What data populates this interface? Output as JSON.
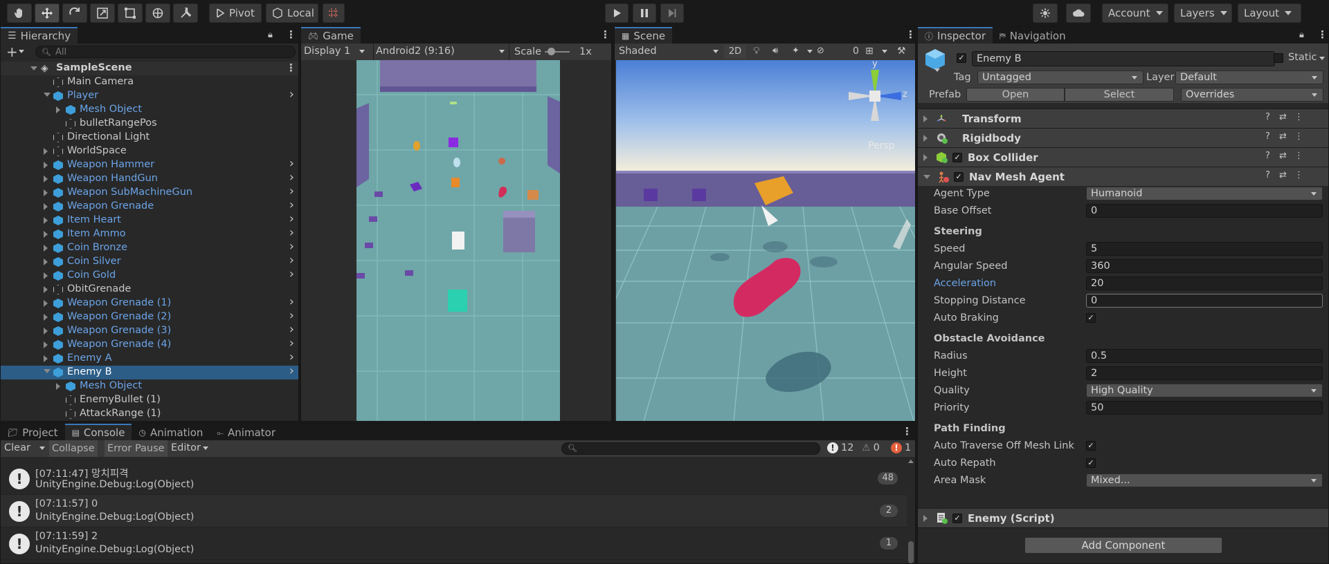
{
  "toolbar": {
    "pivot": "Pivot",
    "local": "Local",
    "account": "Account",
    "layers": "Layers",
    "layout": "Layout"
  },
  "hierarchy": {
    "tab": "Hierarchy",
    "search_placeholder": "All",
    "scene": "SampleScene",
    "items": [
      {
        "label": "Main Camera",
        "indent": 1,
        "icon": "cube-grey",
        "arrow": "",
        "blue": false,
        "chev": false
      },
      {
        "label": "Player",
        "indent": 1,
        "icon": "cube-blue",
        "arrow": "down",
        "blue": true,
        "chev": true
      },
      {
        "label": "Mesh Object",
        "indent": 2,
        "icon": "cube-blue",
        "arrow": "right",
        "blue": true,
        "chev": false
      },
      {
        "label": "bulletRangePos",
        "indent": 2,
        "icon": "cube-grey-fx",
        "arrow": "",
        "blue": false,
        "chev": false
      },
      {
        "label": "Directional Light",
        "indent": 1,
        "icon": "cube-grey",
        "arrow": "",
        "blue": false,
        "chev": false
      },
      {
        "label": "WorldSpace",
        "indent": 1,
        "icon": "cube-grey",
        "arrow": "right",
        "blue": false,
        "chev": false
      },
      {
        "label": "Weapon Hammer",
        "indent": 1,
        "icon": "cube-blue",
        "arrow": "right",
        "blue": true,
        "chev": true
      },
      {
        "label": "Weapon HandGun",
        "indent": 1,
        "icon": "cube-blue",
        "arrow": "right",
        "blue": true,
        "chev": true
      },
      {
        "label": "Weapon SubMachineGun",
        "indent": 1,
        "icon": "cube-blue",
        "arrow": "right",
        "blue": true,
        "chev": true
      },
      {
        "label": "Weapon Grenade",
        "indent": 1,
        "icon": "cube-blue",
        "arrow": "right",
        "blue": true,
        "chev": true
      },
      {
        "label": "Item Heart",
        "indent": 1,
        "icon": "cube-blue",
        "arrow": "right",
        "blue": true,
        "chev": true
      },
      {
        "label": "Item Ammo",
        "indent": 1,
        "icon": "cube-blue",
        "arrow": "right",
        "blue": true,
        "chev": true
      },
      {
        "label": "Coin Bronze",
        "indent": 1,
        "icon": "cube-blue",
        "arrow": "right",
        "blue": true,
        "chev": true
      },
      {
        "label": "Coin Silver",
        "indent": 1,
        "icon": "cube-blue",
        "arrow": "right",
        "blue": true,
        "chev": true
      },
      {
        "label": "Coin Gold",
        "indent": 1,
        "icon": "cube-blue",
        "arrow": "right",
        "blue": true,
        "chev": true
      },
      {
        "label": "ObitGrenade",
        "indent": 1,
        "icon": "cube-grey",
        "arrow": "right",
        "blue": false,
        "chev": false
      },
      {
        "label": "Weapon Grenade (1)",
        "indent": 1,
        "icon": "cube-blue",
        "arrow": "right",
        "blue": true,
        "chev": true
      },
      {
        "label": "Weapon Grenade (2)",
        "indent": 1,
        "icon": "cube-blue",
        "arrow": "right",
        "blue": true,
        "chev": true
      },
      {
        "label": "Weapon Grenade (3)",
        "indent": 1,
        "icon": "cube-blue",
        "arrow": "right",
        "blue": true,
        "chev": true
      },
      {
        "label": "Weapon Grenade (4)",
        "indent": 1,
        "icon": "cube-blue",
        "arrow": "right",
        "blue": true,
        "chev": true
      },
      {
        "label": "Enemy A",
        "indent": 1,
        "icon": "cube-blue",
        "arrow": "right",
        "blue": true,
        "chev": true
      },
      {
        "label": "Enemy B",
        "indent": 1,
        "icon": "cube-blue",
        "arrow": "down",
        "blue": false,
        "chev": true,
        "selected": true
      },
      {
        "label": "Mesh Object",
        "indent": 2,
        "icon": "cube-blue",
        "arrow": "right",
        "blue": true,
        "chev": false
      },
      {
        "label": "EnemyBullet (1)",
        "indent": 2,
        "icon": "cube-grey",
        "arrow": "",
        "blue": false,
        "chev": false
      },
      {
        "label": "AttackRange (1)",
        "indent": 2,
        "icon": "cube-grey-fx",
        "arrow": "",
        "blue": false,
        "chev": false
      }
    ]
  },
  "game": {
    "tab": "Game",
    "display": "Display 1",
    "aspect": "Android2 (9:16)",
    "scale_label": "Scale",
    "scale_value": "1x"
  },
  "scene": {
    "tab": "Scene",
    "shading": "Shaded",
    "mode2d": "2D",
    "hidden_count": "0",
    "gizmo_y": "y",
    "gizmo_z": "z",
    "persp": "Persp"
  },
  "inspector": {
    "tab": "Inspector",
    "tab2": "Navigation",
    "object_name": "Enemy B",
    "static": "Static",
    "tag_label": "Tag",
    "tag_value": "Untagged",
    "layer_label": "Layer",
    "layer_value": "Default",
    "prefab_label": "Prefab",
    "prefab_open": "Open",
    "prefab_select": "Select",
    "prefab_overrides": "Overrides",
    "components": {
      "transform": "Transform",
      "rigidbody": "Rigidbody",
      "box_collider": "Box Collider",
      "nav_mesh_agent": "Nav Mesh Agent",
      "enemy_script": "Enemy (Script)"
    },
    "nav": {
      "agent_type_label": "Agent Type",
      "agent_type": "Humanoid",
      "base_offset_label": "Base Offset",
      "base_offset": "0",
      "steering": "Steering",
      "speed_label": "Speed",
      "speed": "5",
      "angular_speed_label": "Angular Speed",
      "angular_speed": "360",
      "acceleration_label": "Acceleration",
      "acceleration": "20",
      "stopping_distance_label": "Stopping Distance",
      "stopping_distance": "0",
      "auto_braking_label": "Auto Braking",
      "obstacle_avoidance": "Obstacle Avoidance",
      "radius_label": "Radius",
      "radius": "0.5",
      "height_label": "Height",
      "height": "2",
      "quality_label": "Quality",
      "quality": "High Quality",
      "priority_label": "Priority",
      "priority": "50",
      "path_finding": "Path Finding",
      "auto_traverse_label": "Auto Traverse Off Mesh Link",
      "auto_repath_label": "Auto Repath",
      "area_mask_label": "Area Mask",
      "area_mask": "Mixed..."
    },
    "add_component": "Add Component"
  },
  "console": {
    "tab_project": "Project",
    "tab_console": "Console",
    "tab_animation": "Animation",
    "tab_animator": "Animator",
    "clear": "Clear",
    "collapse": "Collapse",
    "error_pause": "Error Pause",
    "editor": "Editor",
    "count_log": "12",
    "count_warn": "0",
    "count_err": "1",
    "logs": [
      {
        "time_msg": "[07:11:47] 망치피격",
        "detail": "UnityEngine.Debug:Log(Object)",
        "count": "48"
      },
      {
        "time_msg": "[07:11:57] 0",
        "detail": "UnityEngine.Debug:Log(Object)",
        "count": "2"
      },
      {
        "time_msg": "[07:11:59] 2",
        "detail": "UnityEngine.Debug:Log(Object)",
        "count": "1"
      }
    ]
  }
}
